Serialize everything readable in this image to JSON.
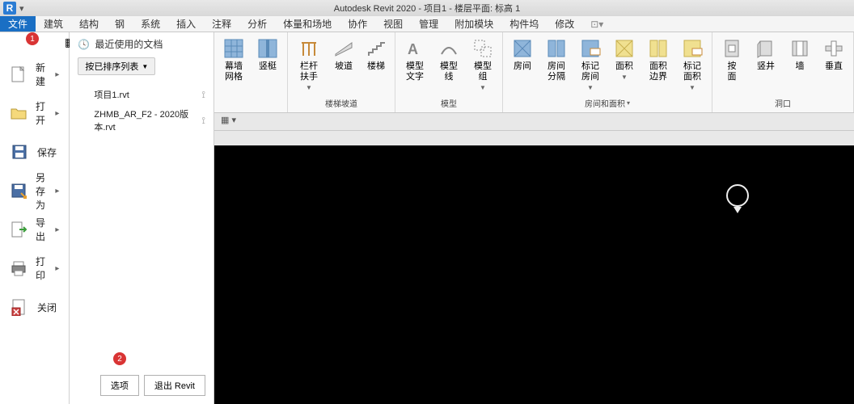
{
  "title": "Autodesk Revit 2020 - 项目1 - 楼层平面: 标高 1",
  "badge1": "1",
  "badge2": "2",
  "menu_tabs": {
    "file": "文件",
    "arch": "建筑",
    "struct": "结构",
    "steel": "钢",
    "system": "系统",
    "insert": "插入",
    "annotate": "注释",
    "analyze": "分析",
    "massing": "体量和场地",
    "collab": "协作",
    "view": "视图",
    "manage": "管理",
    "addins": "附加模块",
    "precast": "构件坞",
    "modify": "修改"
  },
  "sidebar": {
    "new": "新建",
    "open": "打开",
    "save": "保存",
    "saveas": "另存为",
    "export": "导出",
    "print": "打印",
    "close": "关闭"
  },
  "recent": {
    "header": "最近使用的文档",
    "sort_label": "按已排序列表",
    "items": [
      {
        "name": "项目1.rvt"
      },
      {
        "name": "ZHMB_AR_F2 - 2020版本.rvt"
      }
    ]
  },
  "bottom": {
    "options": "选项",
    "exit": "退出 Revit"
  },
  "ribbon": {
    "curtain_grid": "幕墙\n网格",
    "mullion": "竖梃",
    "railing": "栏杆扶手",
    "ramp": "坡道",
    "stair": "楼梯",
    "model_text": "模型\n文字",
    "model_line": "模型\n线",
    "model_group": "模型\n组",
    "room": "房间",
    "room_sep": "房间\n分隔",
    "tag_room": "标记\n房间",
    "area": "面积",
    "area_bound": "面积\n边界",
    "tag_area": "标记\n面积",
    "by_face": "按\n面",
    "shaft": "竖井",
    "wall": "墙",
    "vertical": "垂直",
    "group_circ": "楼梯坡道",
    "group_model": "模型",
    "group_room": "房间和面积",
    "group_open": "洞口"
  }
}
